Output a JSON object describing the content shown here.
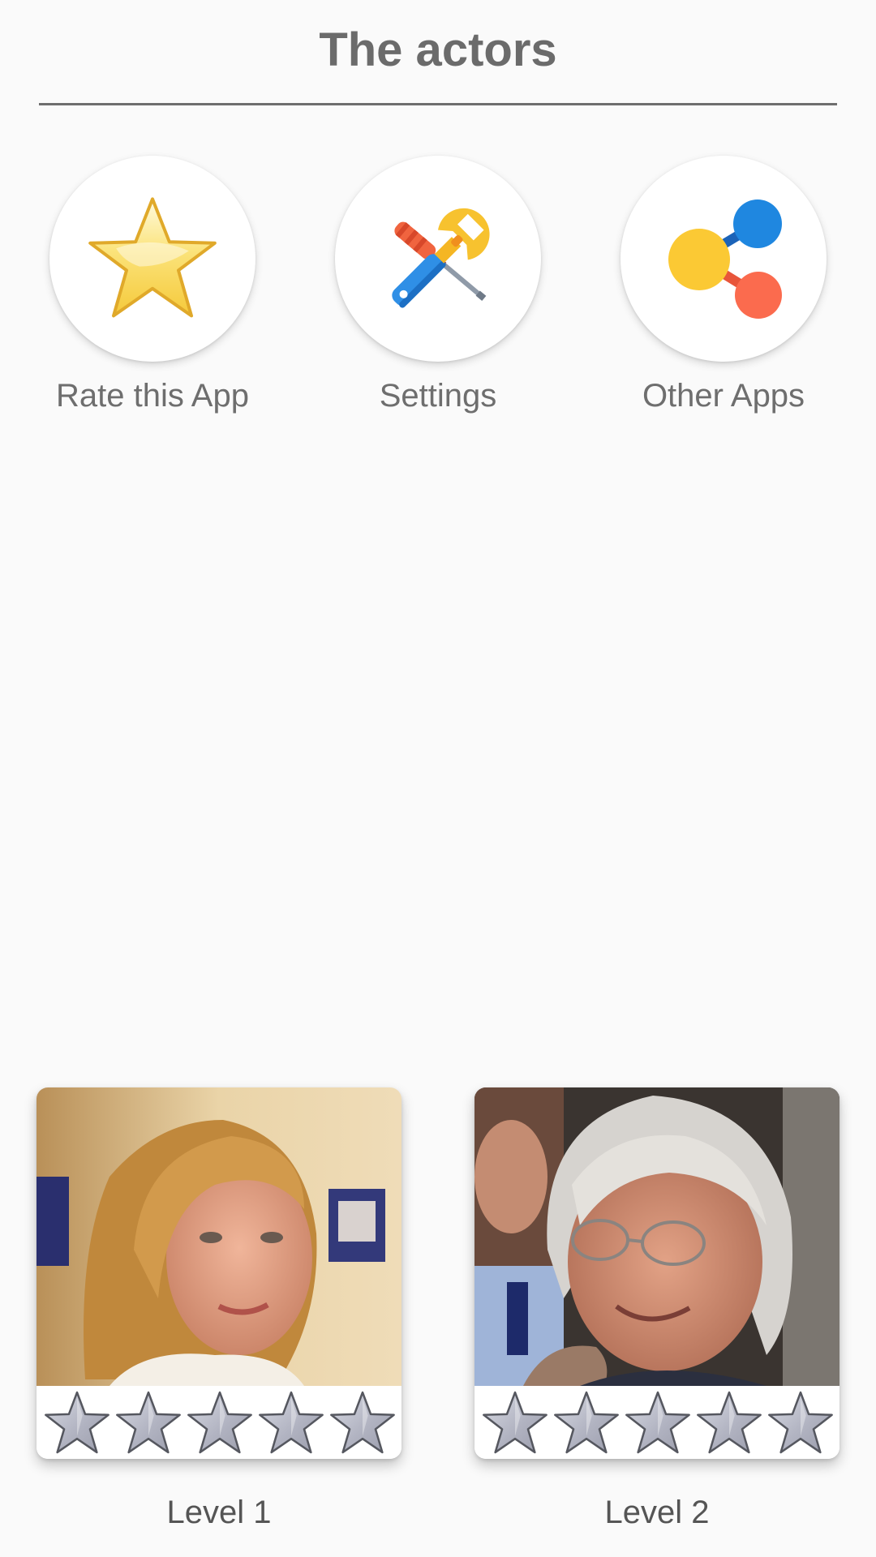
{
  "header": {
    "title": "The actors"
  },
  "actions": [
    {
      "label": "Rate this App",
      "icon": "star-icon"
    },
    {
      "label": "Settings",
      "icon": "tools-icon"
    },
    {
      "label": "Other Apps",
      "icon": "share-icon"
    }
  ],
  "levels": [
    {
      "label": "Level 1",
      "stars_earned": 0,
      "stars_total": 5
    },
    {
      "label": "Level 2",
      "stars_earned": 0,
      "stars_total": 5
    }
  ],
  "colors": {
    "star_gold": "#f8d64a",
    "star_empty": "#b8bac6",
    "title_gray": "#6b6b6b"
  }
}
